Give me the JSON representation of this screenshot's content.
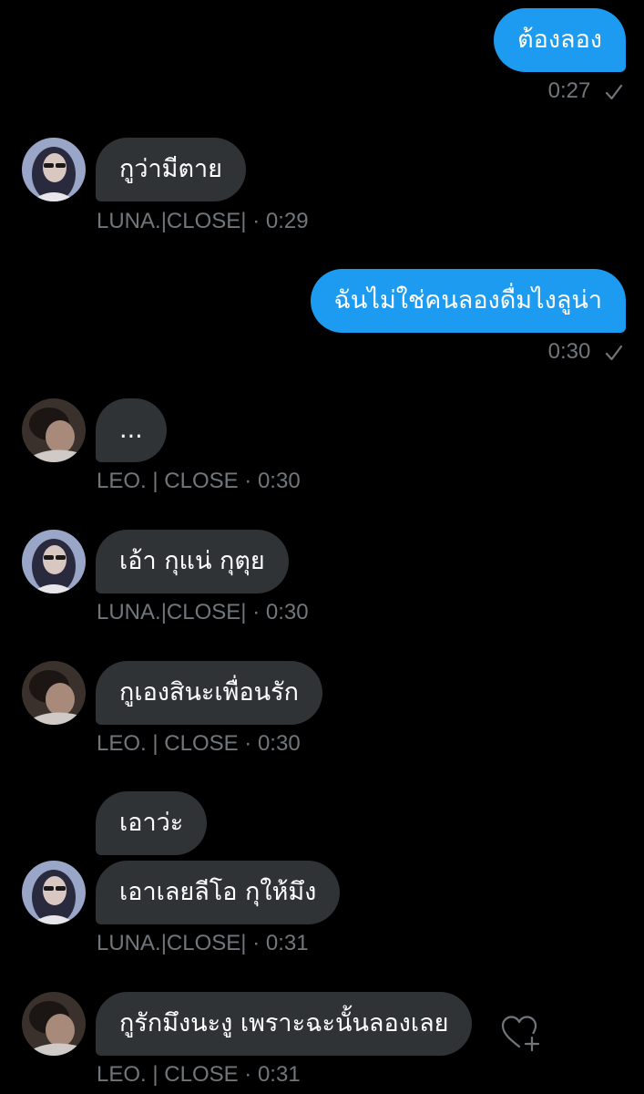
{
  "messages": [
    {
      "text": "ต้องลอง",
      "meta": "0:27"
    },
    {
      "text": "กูว่ามีตาย",
      "meta": "LUNA.|CLOSE| · 0:29"
    },
    {
      "text": "ฉันไม่ใช่คนลองดื่มไงลูน่า",
      "meta": "0:30"
    },
    {
      "text": "...",
      "meta": "LEO. | CLOSE · 0:30"
    },
    {
      "text": "เอ้า กุแน่ กุตุย",
      "meta": "LUNA.|CLOSE| · 0:30"
    },
    {
      "text": "กูเองสินะเพื่อนรัก",
      "meta": "LEO. | CLOSE · 0:30"
    },
    {
      "text": "เอาว่ะ"
    },
    {
      "text": "เอาเลยลีโอ กุให้มึง",
      "meta": "LUNA.|CLOSE| · 0:31"
    },
    {
      "text": "กูรักมึงนะงู เพราะฉะนั้นลองเลย",
      "meta": "LEO. | CLOSE · 0:31"
    }
  ],
  "colors": {
    "outgoing_bubble": "#1d9bf0",
    "incoming_bubble": "#2f3336",
    "meta_text": "#71767b",
    "background": "#000000"
  },
  "icons": {
    "sent_check": "check-icon",
    "react": "heart-add-icon"
  }
}
